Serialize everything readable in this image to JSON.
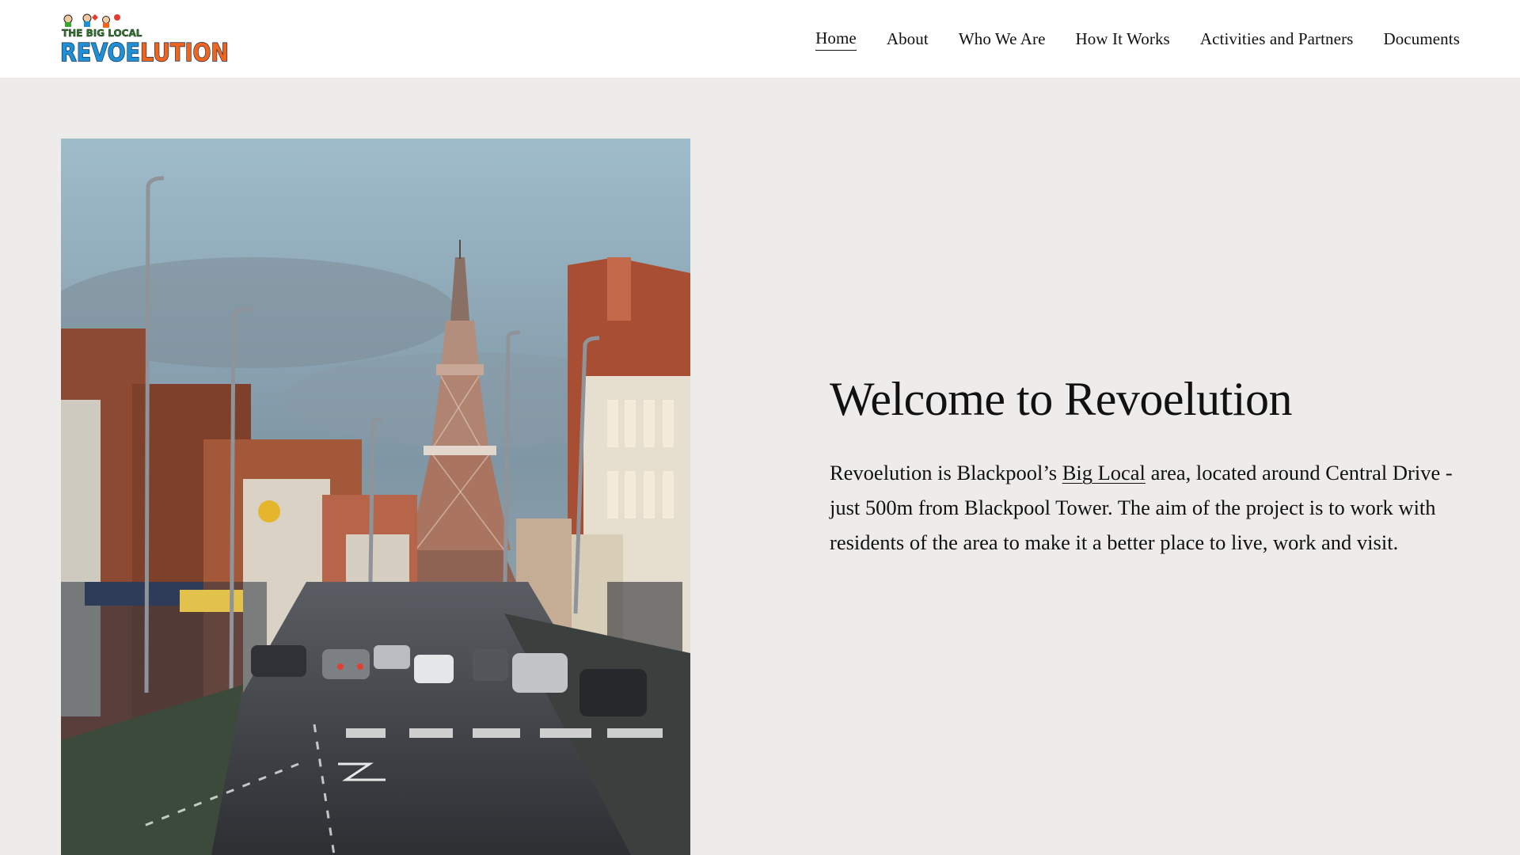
{
  "site": {
    "logo": {
      "top_text": "THE BIG LOCAL",
      "wordmark_part1": "REVOE",
      "wordmark_part2": "LUTION"
    }
  },
  "nav": {
    "items": [
      {
        "label": "Home",
        "active": true
      },
      {
        "label": "About"
      },
      {
        "label": "Who We Are"
      },
      {
        "label": "How It Works"
      },
      {
        "label": "Activities and Partners"
      },
      {
        "label": "Documents"
      }
    ]
  },
  "hero": {
    "image_icon": "blackpool-tower-street-photo",
    "title": "Welcome to Revoelution",
    "body_before_link": "Revoelution is Blackpool’s ",
    "link_text": "Big Local",
    "body_after_link": " area, located around Central Drive - just 500m from Blackpool Tower. The aim of the project is to work with residents of the area to make it a better place to live, work and visit."
  },
  "colors": {
    "page_background": "#edecea",
    "header_background": "#ffffff",
    "text": "#111111",
    "logo_blue": "#1f8fd6",
    "logo_orange": "#f0641e",
    "logo_green": "#3aa535"
  }
}
